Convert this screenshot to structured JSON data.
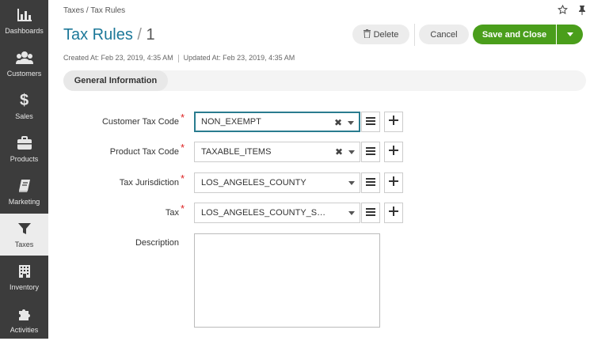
{
  "sidebar": {
    "items": [
      {
        "label": "Dashboards",
        "icon": "dashboard-chart-icon"
      },
      {
        "label": "Customers",
        "icon": "customers-people-icon"
      },
      {
        "label": "Sales",
        "icon": "dollar-icon"
      },
      {
        "label": "Products",
        "icon": "briefcase-icon"
      },
      {
        "label": "Marketing",
        "icon": "book-icon"
      },
      {
        "label": "Taxes",
        "icon": "funnel-icon",
        "active": true
      },
      {
        "label": "Inventory",
        "icon": "building-icon"
      },
      {
        "label": "Activities",
        "icon": "puzzle-icon"
      }
    ]
  },
  "breadcrumb": "Taxes / Tax Rules",
  "title": {
    "entity": "Tax Rules",
    "separator": "/",
    "id": "1"
  },
  "meta": {
    "created": "Created At: Feb 23, 2019, 4:35 AM",
    "updated": "Updated At: Feb 23, 2019, 4:35 AM"
  },
  "actions": {
    "delete": "Delete",
    "cancel": "Cancel",
    "save": "Save and Close"
  },
  "tabs": {
    "general": "General Information"
  },
  "form": {
    "customer_tax_code": {
      "label": "Customer Tax Code",
      "value": "NON_EXEMPT",
      "required": "*"
    },
    "product_tax_code": {
      "label": "Product Tax Code",
      "value": "TAXABLE_ITEMS",
      "required": "*"
    },
    "tax_jurisdiction": {
      "label": "Tax Jurisdiction",
      "value": "LOS_ANGELES_COUNTY",
      "required": "*"
    },
    "tax": {
      "label": "Tax",
      "value": "LOS_ANGELES_COUNTY_SAL...",
      "required": "*"
    },
    "description": {
      "label": "Description",
      "value": ""
    }
  },
  "colors": {
    "sidebar": "#3c3c3c",
    "accent": "#1d7899",
    "save": "#4a9e1b",
    "required": "#dd2222"
  }
}
